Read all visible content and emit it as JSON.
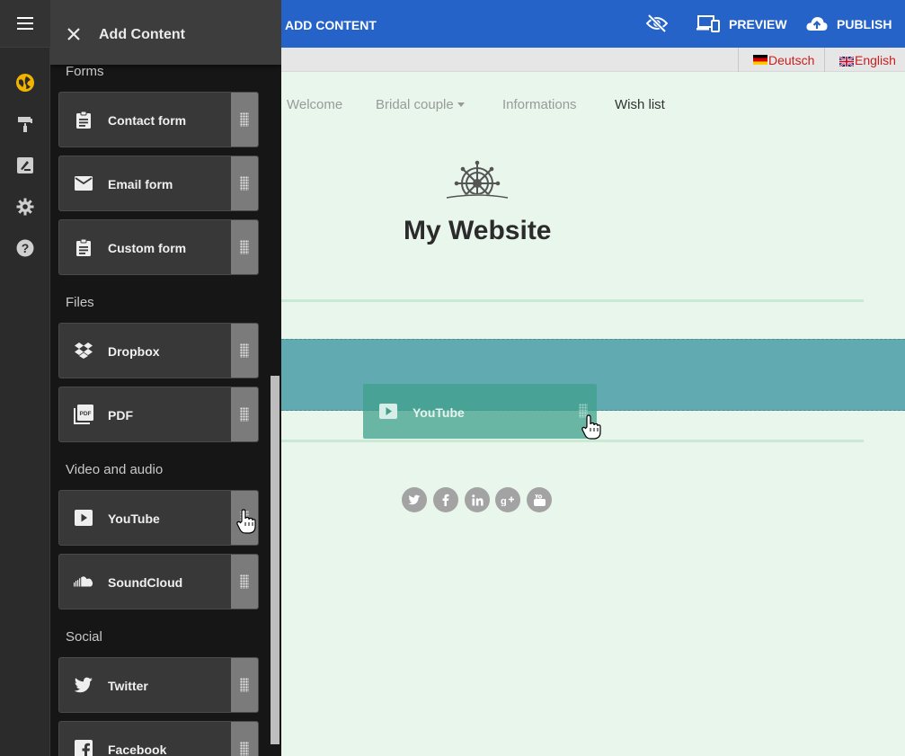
{
  "drawer": {
    "title": "Add Content",
    "sections": {
      "forms": "Forms",
      "files": "Files",
      "video": "Video and audio",
      "social": "Social"
    },
    "items": {
      "contact_form": "Contact form",
      "email_form": "Email form",
      "custom_form": "Custom form",
      "dropbox": "Dropbox",
      "pdf": "PDF",
      "youtube": "YouTube",
      "soundcloud": "SoundCloud",
      "twitter": "Twitter",
      "facebook": "Facebook"
    }
  },
  "rail": {
    "icons": [
      "menu-icon",
      "globe-icon",
      "paint-roller-icon",
      "edit-note-icon",
      "gear-icon",
      "help-icon"
    ],
    "active_color": "#f0b400"
  },
  "topbar": {
    "add_content": "ADD CONTENT",
    "preview": "PREVIEW",
    "publish": "PUBLISH",
    "color": "#2663c9"
  },
  "languages": {
    "de": "Deutsch",
    "en": "English"
  },
  "page": {
    "nav": {
      "welcome": "Welcome",
      "bridal": "Bridal couple",
      "info": "Informations",
      "wish": "Wish list"
    },
    "title": "My Website",
    "dragged_item": "YouTube",
    "social_icons": [
      "twitter-icon",
      "facebook-icon",
      "linkedin-icon",
      "google-plus-icon",
      "youtube-icon"
    ]
  }
}
